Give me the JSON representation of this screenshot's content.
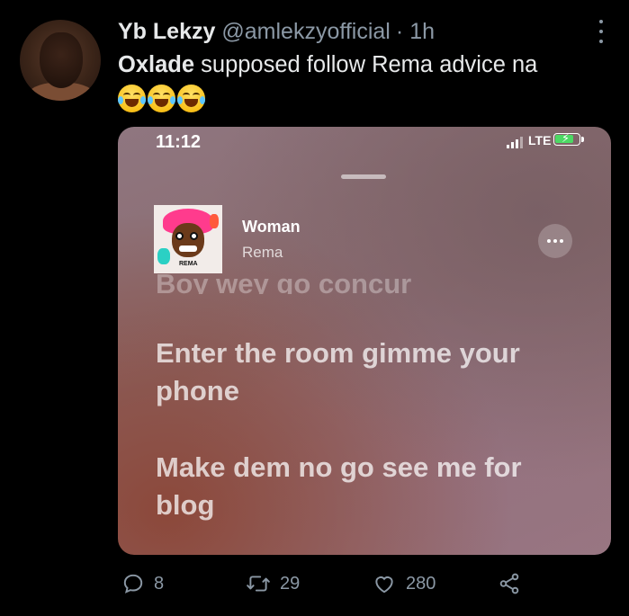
{
  "tweet": {
    "author_name": "Yb Lekzy",
    "author_handle": "@amlekzyofficial",
    "separator": "·",
    "time": "1h",
    "text_bold": "Oxlade",
    "text_rest": " supposed follow Rema advice na",
    "emojis": "face-with-tears-of-joy ×3"
  },
  "media": {
    "status_time": "11:12",
    "network": "LTE",
    "song_title": "Woman",
    "song_artist": "Rema",
    "art_tag": "REMA",
    "lyric_faded": "Boy wey go concur",
    "lyric_1": "Enter the room gimme your phone",
    "lyric_2": "Make dem no go see me for blog"
  },
  "actions": {
    "replies": "8",
    "retweets": "29",
    "likes": "280"
  },
  "colors": {
    "background": "#000000",
    "text_primary": "#e7e9ea",
    "text_secondary": "#8b98a5"
  }
}
